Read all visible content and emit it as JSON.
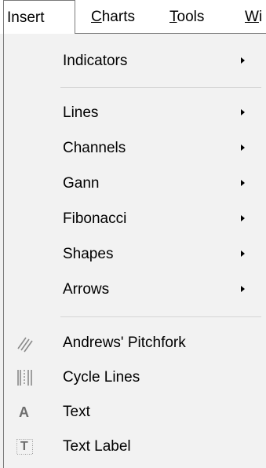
{
  "menubar": {
    "items": [
      {
        "label": "Insert"
      },
      {
        "label_first": "C",
        "label_rest": "harts"
      },
      {
        "label_first": "T",
        "label_rest": "ools"
      },
      {
        "label_first": "W",
        "label_rest": "i"
      }
    ]
  },
  "menu": {
    "items": [
      {
        "label": "Indicators",
        "submenu": true
      },
      {
        "label": "Lines",
        "submenu": true
      },
      {
        "label": "Channels",
        "submenu": true
      },
      {
        "label": "Gann",
        "submenu": true
      },
      {
        "label": "Fibonacci",
        "submenu": true
      },
      {
        "label": "Shapes",
        "submenu": true
      },
      {
        "label": "Arrows",
        "submenu": true
      },
      {
        "label": "Andrews' Pitchfork",
        "icon": "pitchfork-icon"
      },
      {
        "label": "Cycle Lines",
        "icon": "cycle-lines-icon"
      },
      {
        "label": "Text",
        "icon": "text-icon",
        "glyph": "A"
      },
      {
        "label": "Text Label",
        "icon": "text-label-icon",
        "glyph": "T"
      }
    ]
  }
}
